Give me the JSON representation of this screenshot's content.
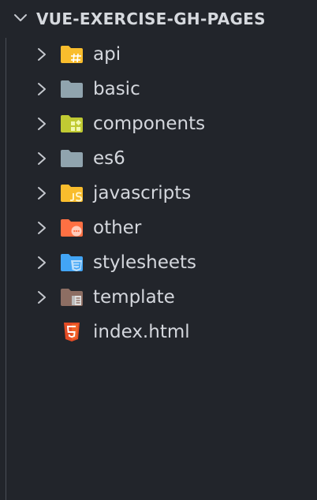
{
  "explorer": {
    "section_title": "VUE-EXERCISE-GH-PAGES",
    "items": [
      {
        "label": "api",
        "kind": "folder",
        "icon": "folder-api-icon",
        "color": "#f9bd2d",
        "badge_color": "#ffffff"
      },
      {
        "label": "basic",
        "kind": "folder",
        "icon": "folder-basic-icon",
        "color": "#90a4ae"
      },
      {
        "label": "components",
        "kind": "folder",
        "icon": "folder-components-icon",
        "color": "#c0ca33",
        "badge_color": "#f1f8b0"
      },
      {
        "label": "es6",
        "kind": "folder",
        "icon": "folder-es6-icon",
        "color": "#90a4ae"
      },
      {
        "label": "javascripts",
        "kind": "folder",
        "icon": "folder-javascript-icon",
        "color": "#f9bd2d",
        "badge_color": "#fff3c4"
      },
      {
        "label": "other",
        "kind": "folder",
        "icon": "folder-other-icon",
        "color": "#ff7043",
        "badge_color": "#ffccbc"
      },
      {
        "label": "stylesheets",
        "kind": "folder",
        "icon": "folder-css-icon",
        "color": "#42a5f5",
        "badge_color": "#bbdefb"
      },
      {
        "label": "template",
        "kind": "folder",
        "icon": "folder-template-icon",
        "color": "#8d6e63",
        "badge_color": "#e0e0e0"
      },
      {
        "label": "index.html",
        "kind": "file",
        "icon": "html5-icon",
        "color": "#e44d26"
      }
    ]
  }
}
